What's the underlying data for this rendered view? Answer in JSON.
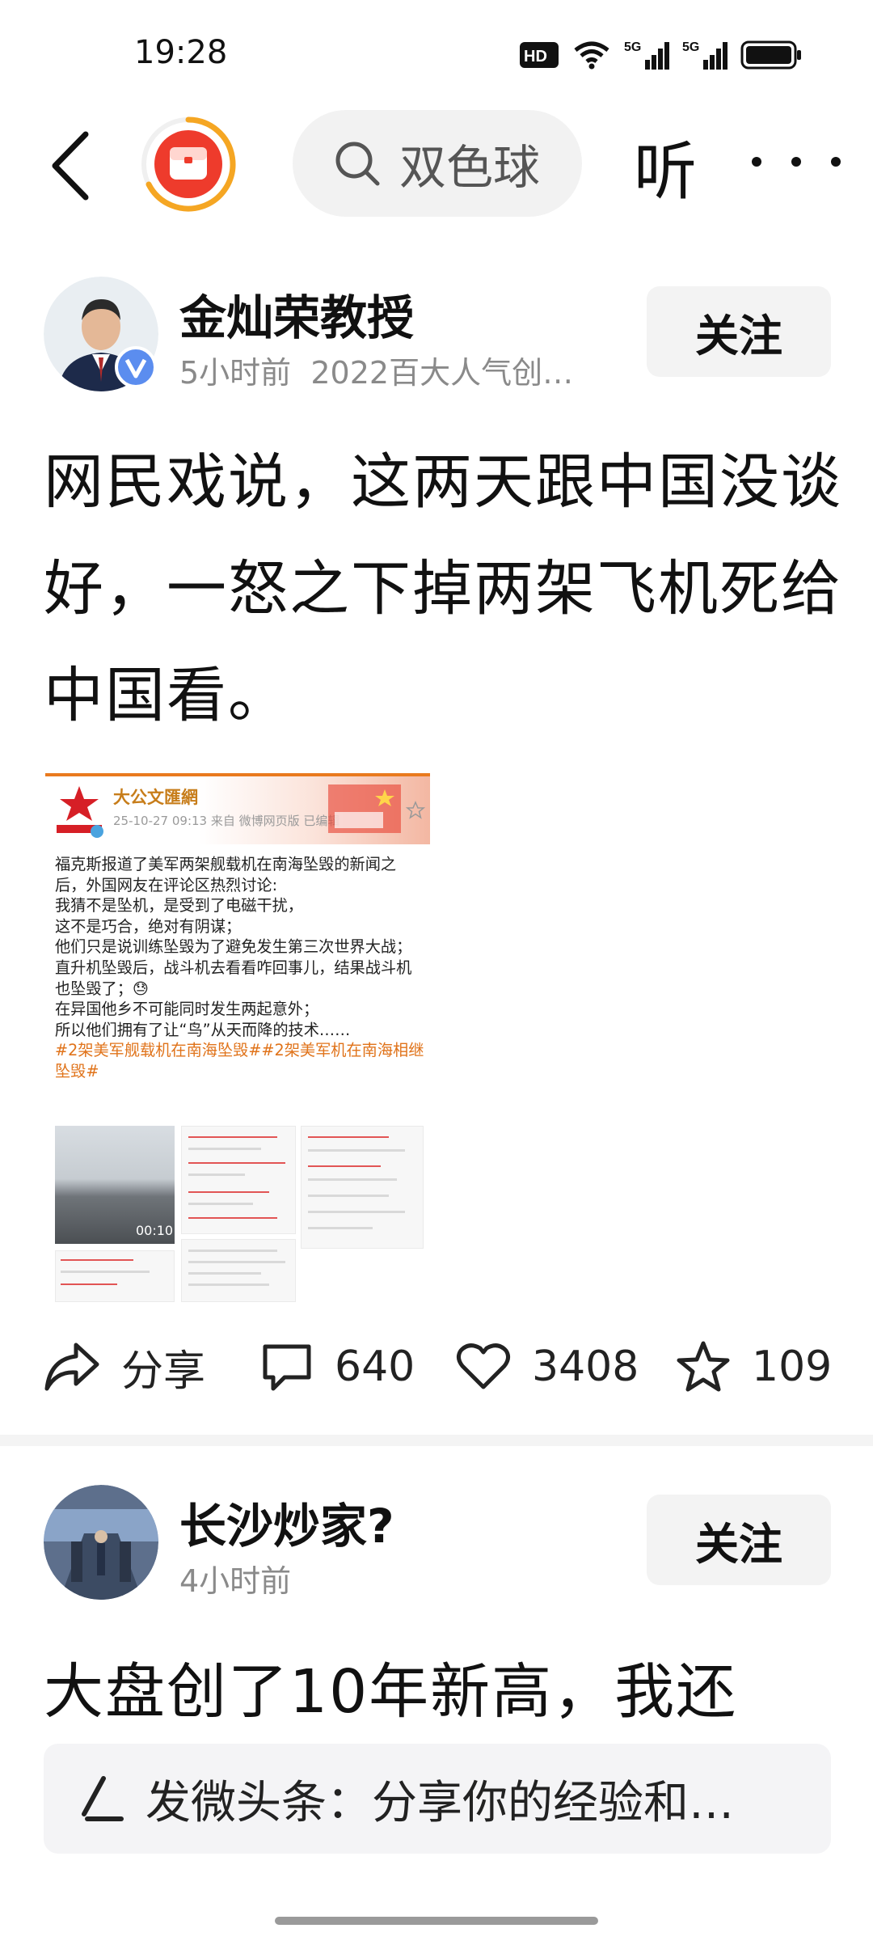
{
  "status_bar": {
    "time": "19:28",
    "hd_label": "HD",
    "signal1": "5G",
    "signal2": "5G"
  },
  "nav": {
    "search_placeholder": "双色球",
    "listen_label": "听"
  },
  "post1": {
    "author": "金灿荣教授",
    "time_ago": "5小时前",
    "tag": "2022百大人气创…",
    "follow_label": "关注",
    "text": "网民戏说，这两天跟中国没谈好，一怒之下掉两架飞机死给中国看。",
    "embed": {
      "account": "大公文匯網",
      "meta": "25-10-27 09:13  来自 微博网页版  已编辑",
      "lines": [
        "福克斯报道了美军两架舰载机在南海坠毁的新闻之后，外国网友在评论区热烈讨论:",
        "我猜不是坠机，是受到了电磁干扰，",
        "这不是巧合，绝对有阴谋；",
        "他们只是说训练坠毁为了避免发生第三次世界大战；",
        "直升机坠毁后，战斗机去看看咋回事儿，结果战斗机也坠毁了；😓",
        "在异国他乡不可能同时发生两起意外；",
        "所以他们拥有了让“鸟”从天而降的技术……"
      ],
      "hashtags": "#2架美军舰载机在南海坠毁##2架美军机在南海相继坠毁#",
      "video_duration": "00:10"
    },
    "share_label": "分享",
    "comments": "640",
    "likes": "3408",
    "favorites": "109"
  },
  "post2": {
    "author": "长沙炒家?",
    "time_ago": "4小时前",
    "follow_label": "关注",
    "text": "大盘创了10年新高，我还"
  },
  "compose": {
    "placeholder": "发微头条：分享你的经验和…"
  },
  "colors": {
    "accent_orange": "#f5a623",
    "app_red": "#e8312a",
    "tag_orange": "#e0731a"
  }
}
